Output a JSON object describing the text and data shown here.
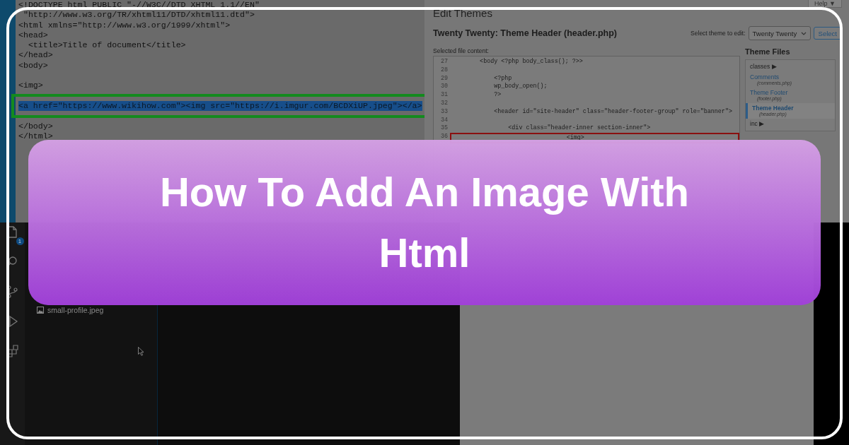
{
  "code_editor": {
    "lines": [
      {
        "kind": "code",
        "text": "<!DOCTYPE html PUBLIC \"-//W3C//DTD XHTML 1.1//EN\""
      },
      {
        "kind": "code",
        "text": " \"http://www.w3.org/TR/xhtml11/DTD/xhtml11.dtd\">"
      },
      {
        "kind": "code",
        "text": "<html xmlns=\"http://www.w3.org/1999/xhtml\">"
      },
      {
        "kind": "code",
        "text": "<head>"
      },
      {
        "kind": "code",
        "text": "  <title>Title of document</title>"
      },
      {
        "kind": "code",
        "text": "</head>"
      },
      {
        "kind": "code",
        "text": "<body>"
      },
      {
        "kind": "blank"
      },
      {
        "kind": "code",
        "text": "<img>"
      },
      {
        "kind": "blank"
      },
      {
        "kind": "highlighted",
        "text": "<a href=\"https://www.wikihow.com\"><img src=\"https://i.imgur.com/BCDXiUP.jpeg\"></a>"
      },
      {
        "kind": "blank"
      },
      {
        "kind": "code",
        "text": "</body>"
      },
      {
        "kind": "code",
        "text": "</html>"
      }
    ]
  },
  "theme_editor": {
    "help_button": "Help ▼",
    "heading": "Edit Themes",
    "file_title": "Twenty Twenty: Theme Header (header.php)",
    "select_label": "Select theme to edit:",
    "theme_select": "Twenty Twenty",
    "select_button": "Select",
    "content_label": "Selected file content:",
    "code_lines": [
      {
        "number": "27",
        "text": "    <body <?php body_class(); ?>>",
        "highlighted": false
      },
      {
        "number": "28",
        "highlighted": false
      },
      {
        "number": "29",
        "text": "        <?php",
        "highlighted": false
      },
      {
        "number": "30",
        "text": "        wp_body_open();",
        "highlighted": false
      },
      {
        "number": "31",
        "text": "        ?>",
        "highlighted": false
      },
      {
        "number": "32",
        "highlighted": false
      },
      {
        "number": "33",
        "text": "        <header id=\"site-header\" class=\"header-footer-group\" role=\"banner\">",
        "highlighted": false
      },
      {
        "number": "34",
        "highlighted": false
      },
      {
        "number": "35",
        "text": "            <div class=\"header-inner section-inner\">",
        "highlighted": false
      },
      {
        "number": "36",
        "text": "                            <img>",
        "highlighted": true
      }
    ],
    "files_heading": "Theme Files",
    "files": [
      {
        "kind": "folder",
        "label": "classes",
        "arrow": "▶",
        "selected": false
      },
      {
        "kind": "file",
        "label": "Comments",
        "file": "(comments.php)",
        "selected": false
      },
      {
        "kind": "file",
        "label": "Theme Footer",
        "file": "(footer.php)",
        "selected": false
      },
      {
        "kind": "file",
        "label": "Theme Header",
        "file": "(header.php)",
        "selected": true
      },
      {
        "kind": "folder",
        "label": "inc",
        "arrow": "▶",
        "selected": false
      }
    ]
  },
  "vscode": {
    "badge": "1",
    "files": [
      {
        "name": "small-profile.jpeg"
      }
    ]
  },
  "banner": {
    "title": "How To Add An Image With Html"
  }
}
